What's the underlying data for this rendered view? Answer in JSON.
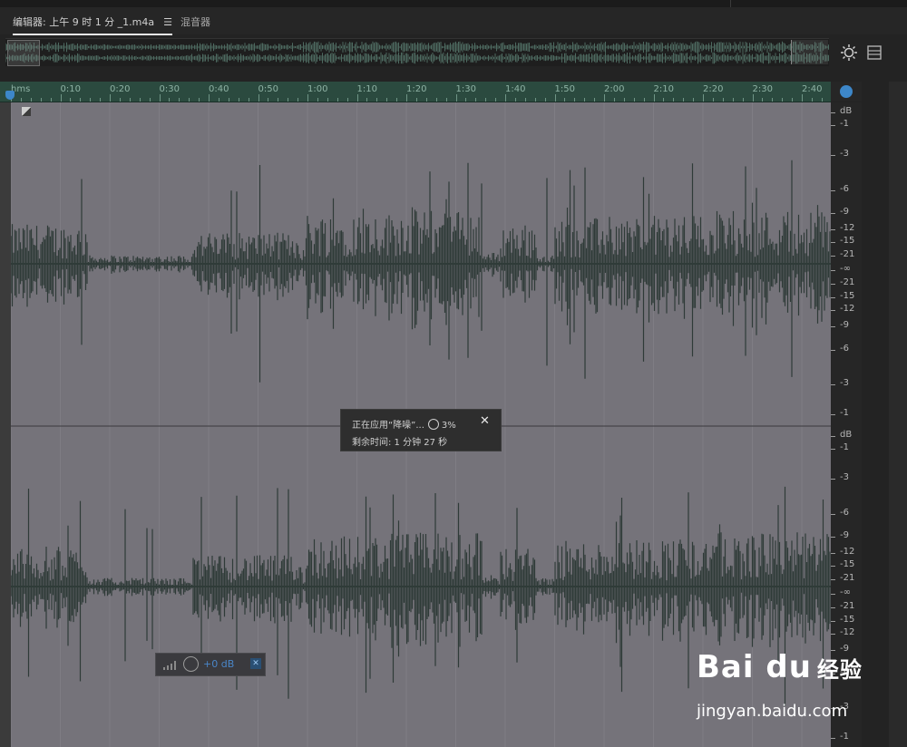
{
  "tabs": {
    "editor": "编辑器: 上午 9 时 1 分 _1.m4a",
    "editor_menu": "☰",
    "mixer": "混音器"
  },
  "ruler": {
    "ticks": [
      "hms",
      "0:10",
      "0:20",
      "0:30",
      "0:40",
      "0:50",
      "1:00",
      "1:10",
      "1:20",
      "1:30",
      "1:40",
      "1:50",
      "2:00",
      "2:10",
      "2:20",
      "2:30",
      "2:40"
    ]
  },
  "db_scale": {
    "top_channel": [
      "dB",
      "-1",
      "-3",
      "-6",
      "-9",
      "-12",
      "-15",
      "-21",
      "-∞",
      "-21",
      "-15",
      "-12",
      "-9",
      "-6",
      "-3",
      "-1"
    ],
    "bottom_channel": [
      "dB",
      "-1",
      "-3",
      "-6",
      "-9",
      "-12",
      "-15",
      "-21",
      "-∞",
      "-21",
      "-15",
      "-12",
      "-9",
      "-6",
      "-3",
      "-1"
    ]
  },
  "progress_dialog": {
    "line1": "正在应用“降噪”...",
    "percent": "3%",
    "line2": "剩余时间: 1 分钟 27 秒",
    "close": "✕"
  },
  "hud": {
    "gain_value": "+0 dB"
  },
  "watermark": {
    "brand": "Bai  du",
    "brand_cn": "经验",
    "url": "jingyan.baidu.com"
  },
  "colors": {
    "waveform": "#2f3b38",
    "waveform_bg": "#75737a",
    "ruler": "#2b4a3f",
    "accent": "#3d87c9"
  },
  "icons": {
    "zoom": "zoom-sun-icon",
    "panel": "panel-list-icon",
    "headphone": "headphone-icon",
    "spinner": "spinner-icon",
    "close": "close-icon",
    "pin": "pin-icon"
  }
}
